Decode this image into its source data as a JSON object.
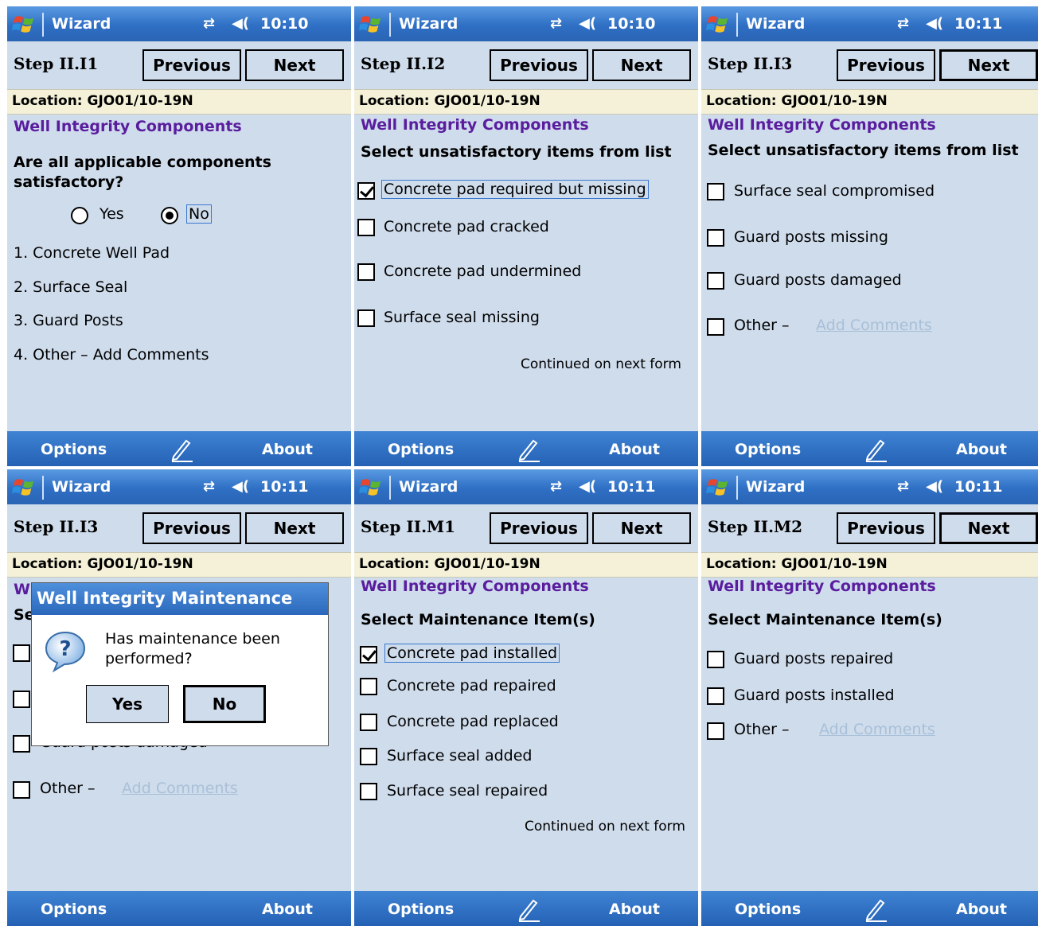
{
  "common": {
    "app_title": "Wizard",
    "prev_label": "Previous",
    "next_label": "Next",
    "location": "Location: GJO01/10-19N",
    "menu_left": "Options",
    "menu_right": "About",
    "heading": "Well Integrity Components",
    "other_label": "Other –",
    "add_comments": "Add Comments",
    "continued": "Continued on next form"
  },
  "p1": {
    "time": "10:10",
    "step": "Step II.I1",
    "question": "Are all applicable components satisfactory?",
    "radio_yes": "Yes",
    "radio_no": "No",
    "selected": "No",
    "items": [
      "1. Concrete Well Pad",
      "2. Surface Seal",
      "3. Guard Posts",
      "4. Other – Add Comments"
    ]
  },
  "p2": {
    "time": "10:10",
    "step": "Step II.I2",
    "instruction": "Select unsatisfactory items from list",
    "items": [
      {
        "label": "Concrete pad required but missing",
        "checked": true
      },
      {
        "label": "Concrete pad cracked",
        "checked": false
      },
      {
        "label": "Concrete pad undermined",
        "checked": false
      },
      {
        "label": "Surface seal missing",
        "checked": false
      }
    ]
  },
  "p3": {
    "time": "10:11",
    "step": "Step II.I3",
    "instruction": "Select unsatisfactory items from list",
    "items": [
      {
        "label": "Surface seal compromised",
        "checked": false
      },
      {
        "label": "Guard posts missing",
        "checked": false
      },
      {
        "label": "Guard posts damaged",
        "checked": false
      }
    ]
  },
  "p4": {
    "time": "10:11",
    "step": "Step II.I3",
    "heading_fragment": "W",
    "sub_fragment": "Se",
    "hidden_label": "Guard posts damaged",
    "dialog": {
      "title": "Well Integrity Maintenance",
      "message": "Has maintenance been performed?",
      "yes": "Yes",
      "no": "No"
    }
  },
  "p5": {
    "time": "10:11",
    "step": "Step II.M1",
    "instruction": "Select Maintenance Item(s)",
    "items": [
      {
        "label": "Concrete pad installed",
        "checked": true
      },
      {
        "label": "Concrete pad repaired",
        "checked": false
      },
      {
        "label": "Concrete pad replaced",
        "checked": false
      },
      {
        "label": "Surface seal added",
        "checked": false
      },
      {
        "label": "Surface seal repaired",
        "checked": false
      }
    ]
  },
  "p6": {
    "time": "10:11",
    "step": "Step II.M2",
    "instruction": "Select Maintenance Item(s)",
    "items": [
      {
        "label": "Guard posts repaired",
        "checked": false
      },
      {
        "label": "Guard posts installed",
        "checked": false
      }
    ]
  }
}
